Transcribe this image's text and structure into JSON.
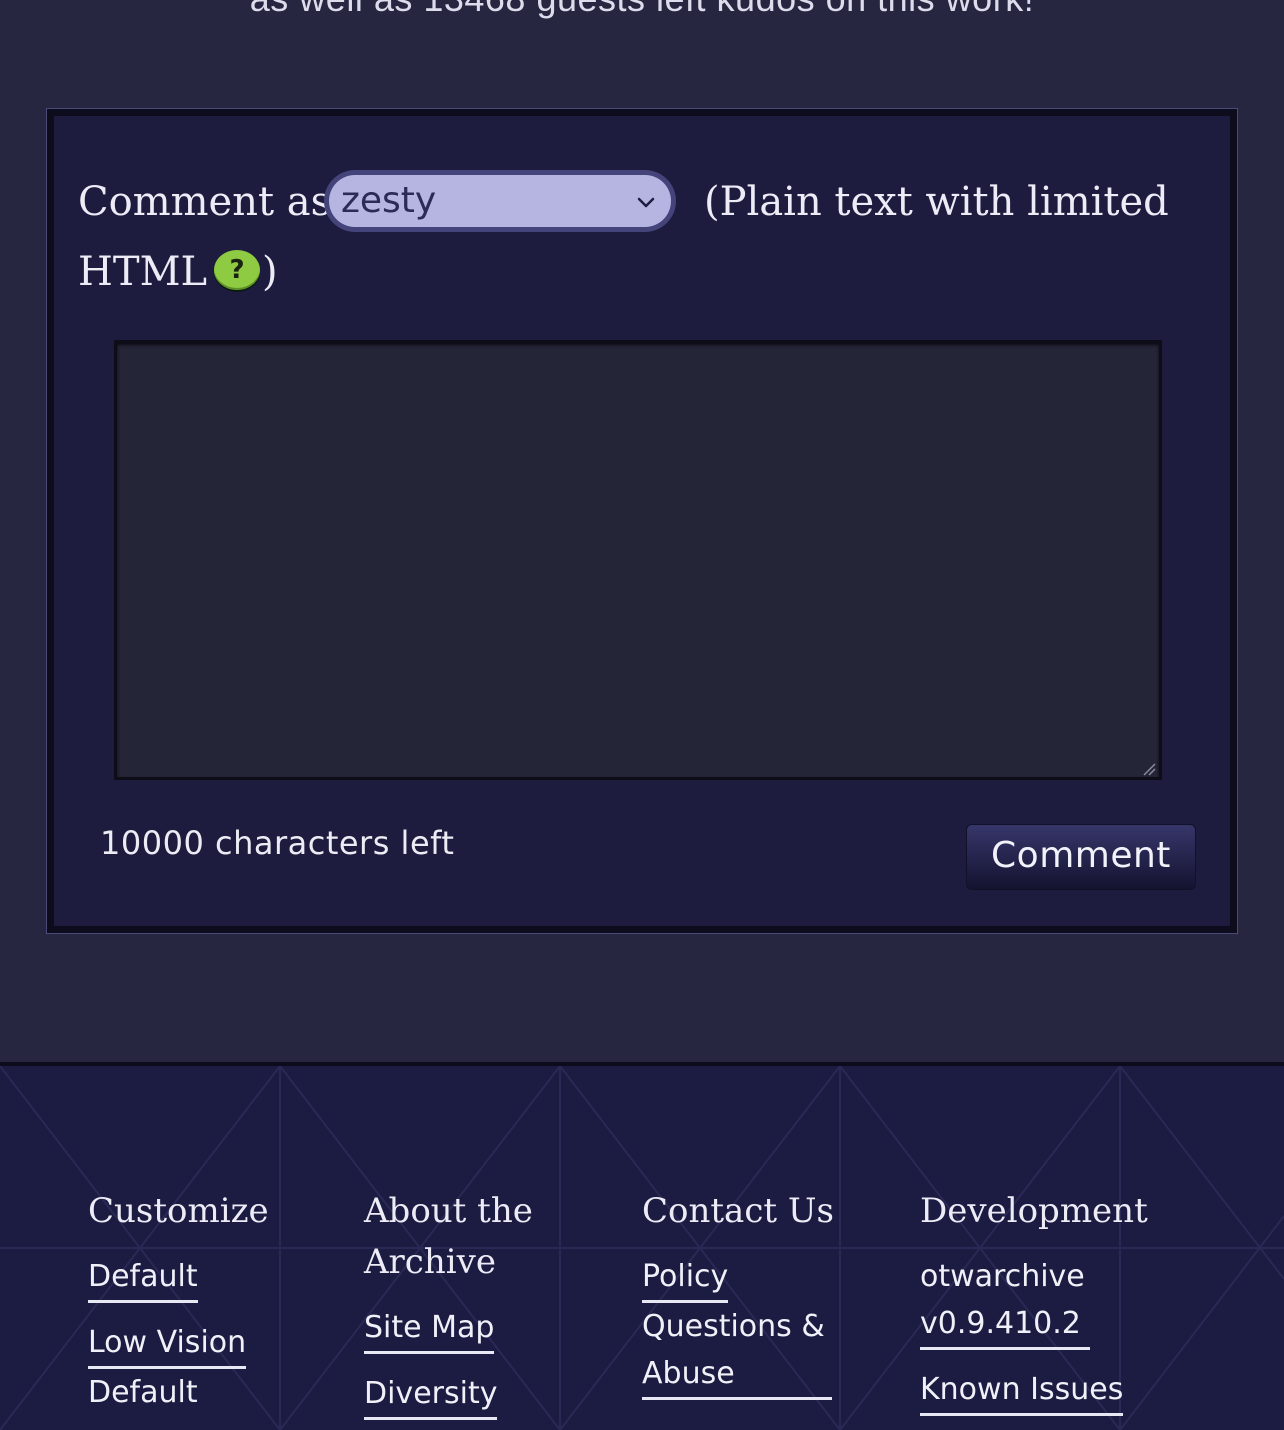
{
  "kudos_line": "as well as 13468 guests left kudos on this work!",
  "comment_form": {
    "comment_as_label": "Comment as",
    "pseud_select_value": "zesty",
    "plain_text_note": "(Plain text with limited",
    "html_label": "HTML",
    "help_icon_glyph": "?",
    "close_paren": ")",
    "textarea_value": "",
    "characters_left": "10000 characters left",
    "submit_label": "Comment"
  },
  "footer": {
    "columns": [
      {
        "heading": "Customize",
        "links": [
          "Default",
          "Low Vision",
          "Default"
        ]
      },
      {
        "heading": "About the Archive",
        "links": [
          "Site Map",
          "Diversity"
        ]
      },
      {
        "heading": "Contact Us",
        "links": [
          "Policy",
          "Questions & Abuse"
        ]
      },
      {
        "heading": "Development",
        "links": [
          "otwarchive v0.9.410.2",
          "Known Issues"
        ]
      }
    ]
  },
  "colors": {
    "page_background": "#262640",
    "form_background": "#1d1c3e",
    "select_background": "#b6b5e2",
    "help_icon": "#8ecb43",
    "footer_background": "#1c1b42"
  }
}
